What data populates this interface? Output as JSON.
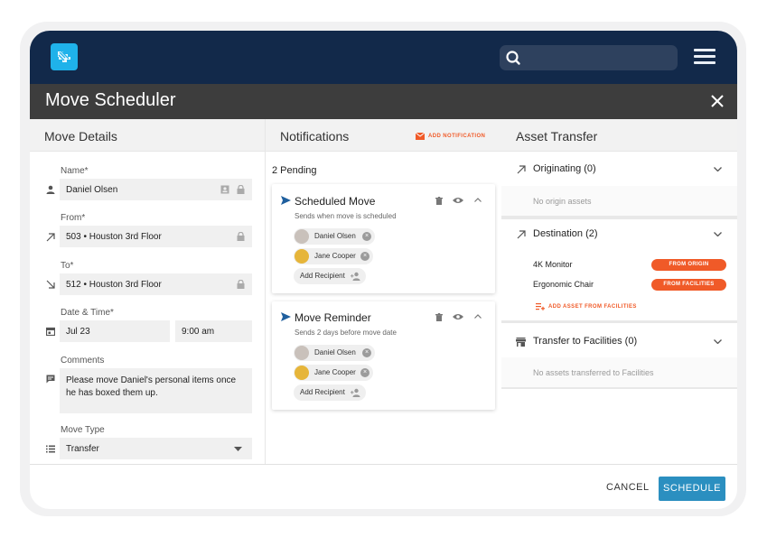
{
  "header": {
    "logo_icon": "stairs-logo-icon",
    "search_placeholder": "",
    "menu_icon": "hamburger-menu-icon"
  },
  "dialog": {
    "title": "Move Scheduler",
    "close_icon": "close-icon"
  },
  "move_details": {
    "heading": "Move Details",
    "name_label": "Name*",
    "name_value": "Daniel Olsen",
    "from_label": "From*",
    "from_value": "503 • Houston 3rd Floor",
    "to_label": "To*",
    "to_value": "512 • Houston 3rd Floor",
    "datetime_label": "Date & Time*",
    "date_value": "Jul 23",
    "time_value": "9:00 am",
    "comments_label": "Comments",
    "comments_value": "Please move Daniel's personal items once he has boxed them up.",
    "move_type_label": "Move Type",
    "move_type_value": "Transfer"
  },
  "notifications": {
    "heading": "Notifications",
    "add_label": "ADD NOTIFICATION",
    "pending": "2 Pending",
    "cards": [
      {
        "title": "Scheduled Move",
        "subtitle": "Sends when move is scheduled",
        "recipients": [
          "Daniel Olsen",
          "Jane Cooper"
        ],
        "add_recipient": "Add Recipient"
      },
      {
        "title": "Move Reminder",
        "subtitle": "Sends 2 days before move date",
        "recipients": [
          "Daniel Olsen",
          "Jane Cooper"
        ],
        "add_recipient": "Add Recipient"
      }
    ]
  },
  "asset_transfer": {
    "heading": "Asset Transfer",
    "originating": "Originating (0)",
    "no_origin": "No origin assets",
    "destination": "Destination (2)",
    "assets": [
      {
        "name": "4K Monitor",
        "badge": "FROM ORIGIN"
      },
      {
        "name": "Ergonomic Chair",
        "badge": "FROM FACILITIES"
      }
    ],
    "add_asset": "ADD ASSET FROM FACILITIES",
    "transfer_facilities": "Transfer to Facilities (0)",
    "no_transferred": "No assets transferred to Facilities"
  },
  "footer": {
    "cancel": "CANCEL",
    "schedule": "SCHEDULE"
  },
  "colors": {
    "topbar": "#12294a",
    "titlebar": "#3d3d3d",
    "accent_orange": "#f05a28",
    "primary_blue": "#2b8fc0",
    "logo_blue": "#1fb2ea"
  }
}
